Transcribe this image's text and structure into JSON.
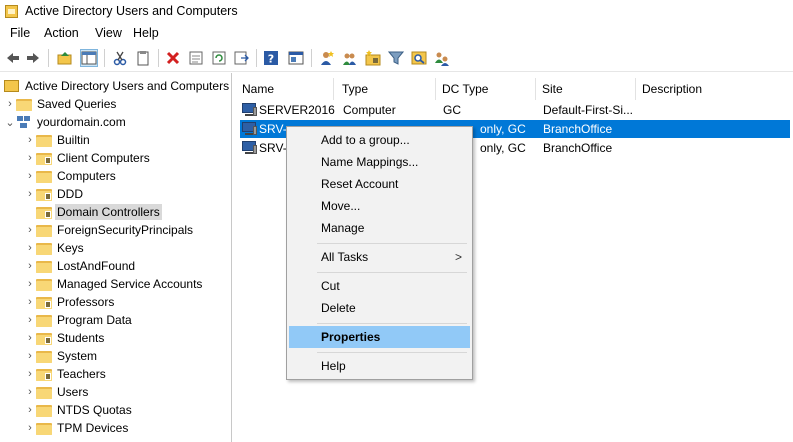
{
  "window": {
    "title": "Active Directory Users and Computers"
  },
  "menubar": {
    "items": [
      "File",
      "Action",
      "View",
      "Help"
    ]
  },
  "toolbar": {
    "icons": [
      "back-arrow-icon",
      "forward-arrow-icon",
      "up-folder-icon",
      "console-tree-icon",
      "cut-icon",
      "copy-icon",
      "delete-icon",
      "properties-icon",
      "refresh-icon",
      "export-list-icon",
      "help-icon",
      "mmc-icon",
      "new-user-icon",
      "new-group-icon",
      "new-ou-icon",
      "filter-icon",
      "find-icon",
      "add-to-group-icon"
    ]
  },
  "tree": {
    "root": "Active Directory Users and Computers",
    "saved_queries": "Saved Queries",
    "domain": "yourdomain.com",
    "children": [
      {
        "label": "Builtin",
        "type": "folder"
      },
      {
        "label": "Client Computers",
        "type": "ou"
      },
      {
        "label": "Computers",
        "type": "folder"
      },
      {
        "label": "DDD",
        "type": "ou"
      },
      {
        "label": "Domain Controllers",
        "type": "ou",
        "selected": true
      },
      {
        "label": "ForeignSecurityPrincipals",
        "type": "folder"
      },
      {
        "label": "Keys",
        "type": "folder"
      },
      {
        "label": "LostAndFound",
        "type": "folder"
      },
      {
        "label": "Managed Service Accounts",
        "type": "folder"
      },
      {
        "label": "Professors",
        "type": "ou"
      },
      {
        "label": "Program Data",
        "type": "folder"
      },
      {
        "label": "Students",
        "type": "ou"
      },
      {
        "label": "System",
        "type": "folder"
      },
      {
        "label": "Teachers",
        "type": "ou"
      },
      {
        "label": "Users",
        "type": "folder"
      },
      {
        "label": "NTDS Quotas",
        "type": "folder"
      },
      {
        "label": "TPM Devices",
        "type": "folder"
      }
    ]
  },
  "list": {
    "columns": [
      "Name",
      "Type",
      "DC Type",
      "Site",
      "Description"
    ],
    "rows": [
      {
        "name": "SERVER2016",
        "type": "Computer",
        "dctype": "GC",
        "site": "Default-First-Si...",
        "description": ""
      },
      {
        "name": "SRV-",
        "type": "",
        "dctype": "only, GC",
        "site": "BranchOffice",
        "description": "",
        "selected": true
      },
      {
        "name": "SRV-",
        "type": "",
        "dctype": "only, GC",
        "site": "BranchOffice",
        "description": ""
      }
    ]
  },
  "context_menu": {
    "items": [
      {
        "label": "Add to a group..."
      },
      {
        "label": "Name Mappings..."
      },
      {
        "label": "Reset Account"
      },
      {
        "label": "Move..."
      },
      {
        "label": "Manage"
      },
      {
        "label": "All Tasks",
        "submenu": true
      },
      {
        "label": "Cut"
      },
      {
        "label": "Delete"
      },
      {
        "label": "Properties",
        "bold": true,
        "highlighted": true
      },
      {
        "label": "Help"
      }
    ],
    "submenu_arrow": ">"
  },
  "colors": {
    "selection": "#0078d7",
    "menu_highlight": "#91c9f7",
    "tree_selection": "#d9d9d9"
  }
}
